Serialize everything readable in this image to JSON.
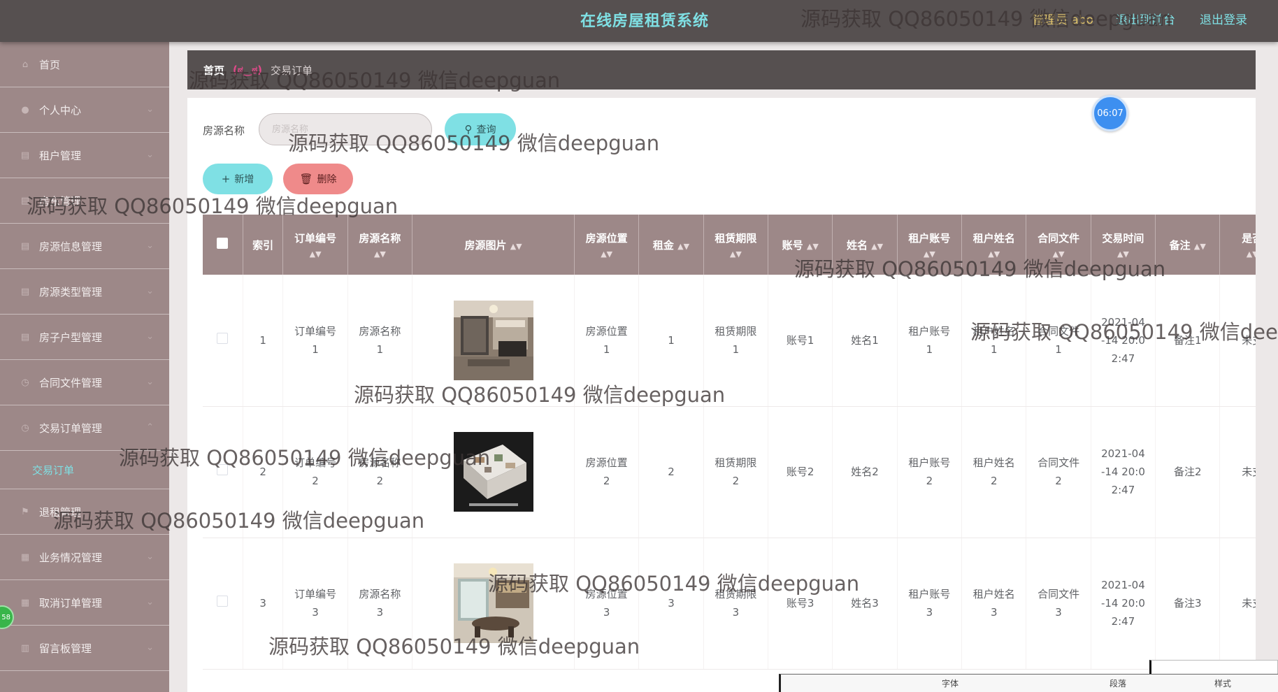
{
  "header": {
    "title": "在线房屋租赁系统",
    "admin": "管理员 abo",
    "to_front": "退出到前台",
    "logout": "退出登录"
  },
  "sidebar": {
    "items": [
      {
        "label": "首页",
        "icon": "home-icon"
      },
      {
        "label": "个人中心",
        "icon": "user-icon"
      },
      {
        "label": "租户管理",
        "icon": "list-icon"
      },
      {
        "label": "房东管理",
        "icon": "list-icon"
      },
      {
        "label": "房源信息管理",
        "icon": "list-icon"
      },
      {
        "label": "房源类型管理",
        "icon": "list-icon"
      },
      {
        "label": "房子户型管理",
        "icon": "list-icon"
      },
      {
        "label": "合同文件管理",
        "icon": "clock-icon"
      },
      {
        "label": "交易订单管理",
        "icon": "clock-icon"
      }
    ],
    "active_sub": "交易订单",
    "items_after": [
      {
        "label": "退租管理",
        "icon": "flag-icon"
      },
      {
        "label": "业务情况管理",
        "icon": "grid-icon"
      },
      {
        "label": "取消订单管理",
        "icon": "grid-icon"
      },
      {
        "label": "留言板管理",
        "icon": "chart-icon"
      }
    ]
  },
  "breadcrumb": {
    "home": "首页",
    "current": "交易订单"
  },
  "search": {
    "label": "房源名称",
    "placeholder": "房源名称",
    "query": "查询"
  },
  "actions": {
    "add": "新增",
    "delete": "删除"
  },
  "table": {
    "headers": {
      "index": "索引",
      "order_no": "订单编号",
      "house_name": "房源名称",
      "house_image": "房源图片",
      "house_location": "房源位置",
      "rent": "租金",
      "lease_term": "租赁期限",
      "account": "账号",
      "name": "姓名",
      "tenant_account": "租户账号",
      "tenant_name": "租户姓名",
      "contract": "合同文件",
      "trade_time": "交易时间",
      "remark": "备注",
      "is_paid": "是否"
    },
    "rows": [
      {
        "index": "1",
        "order_no": [
          "订单编号",
          "1"
        ],
        "house_name": [
          "房源名称",
          "1"
        ],
        "location": [
          "房源位置",
          "1"
        ],
        "rent": "1",
        "term": [
          "租赁期限",
          "1"
        ],
        "account": "账号1",
        "name": "姓名1",
        "tenant_account": [
          "租户账号",
          "1"
        ],
        "tenant_name": [
          "租户姓名",
          "1"
        ],
        "contract": [
          "合同文件",
          "1"
        ],
        "time": [
          "2021-04",
          "-14 20:0",
          "2:47"
        ],
        "remark": "备注1",
        "paid": "未支"
      },
      {
        "index": "2",
        "order_no": [
          "订单编号",
          "2"
        ],
        "house_name": [
          "房源名称",
          "2"
        ],
        "location": [
          "房源位置",
          "2"
        ],
        "rent": "2",
        "term": [
          "租赁期限",
          "2"
        ],
        "account": "账号2",
        "name": "姓名2",
        "tenant_account": [
          "租户账号",
          "2"
        ],
        "tenant_name": [
          "租户姓名",
          "2"
        ],
        "contract": [
          "合同文件",
          "2"
        ],
        "time": [
          "2021-04",
          "-14 20:0",
          "2:47"
        ],
        "remark": "备注2",
        "paid": "未支"
      },
      {
        "index": "3",
        "order_no": [
          "订单编号",
          "3"
        ],
        "house_name": [
          "房源名称",
          "3"
        ],
        "location": [
          "房源位置",
          "3"
        ],
        "rent": "3",
        "term": [
          "租赁期限",
          "3"
        ],
        "account": "账号3",
        "name": "姓名3",
        "tenant_account": [
          "租户账号",
          "3"
        ],
        "tenant_name": [
          "租户姓名",
          "3"
        ],
        "contract": [
          "合同文件",
          "3"
        ],
        "time": [
          "2021-04",
          "-14 20:0",
          "2:47"
        ],
        "remark": "备注3",
        "paid": "未支"
      }
    ]
  },
  "overlay": {
    "clock": "06:07",
    "green_badge": "58",
    "watermark": "源码获取 QQ86050149 微信deepguan",
    "toolbar_labels": [
      "字体",
      "段落",
      "样式"
    ]
  },
  "colors": {
    "topbar": "#565050",
    "sidebar": "#9d8888",
    "accent": "#7fe0e4",
    "danger": "#ef8a8a",
    "clock": "#3d8ff0"
  }
}
